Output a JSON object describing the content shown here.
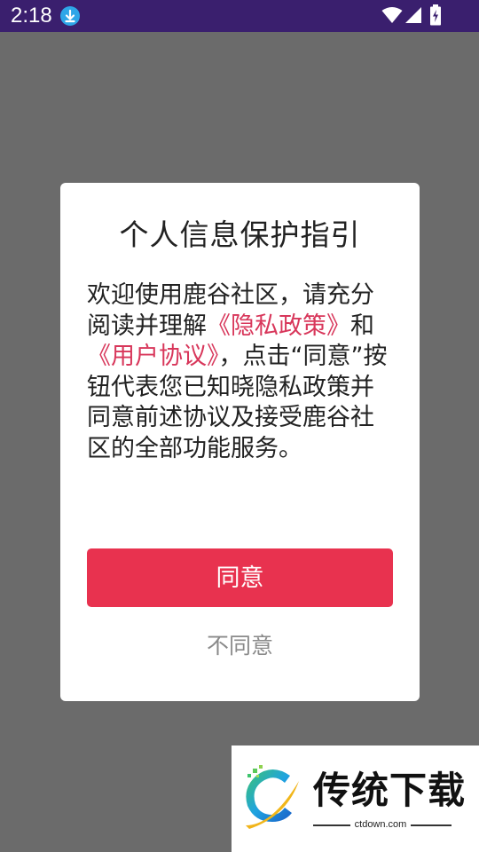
{
  "status_bar": {
    "time": "2:18",
    "download_icon": "download-icon",
    "wifi_icon": "wifi-icon",
    "signal_icon": "cell-signal-icon",
    "battery_icon": "battery-charging-icon",
    "background": "#3a1f6e"
  },
  "dialog": {
    "title": "个人信息保护指引",
    "body_part1": "欢迎使用鹿谷社区，请充分阅读并理解",
    "privacy_link": "《隐私政策》",
    "body_and": "和",
    "agreement_link": "《用户协议》",
    "body_part2": "，点击“同意”按钮代表您已知晓隐私政策并同意前述协议及接受鹿谷社区的全部功能服务。",
    "agree_label": "同意",
    "disagree_label": "不同意",
    "accent_color": "#e8324f",
    "link_color": "#d8375b"
  },
  "watermark": {
    "name": "传统下载",
    "url": "ctdown.com"
  }
}
